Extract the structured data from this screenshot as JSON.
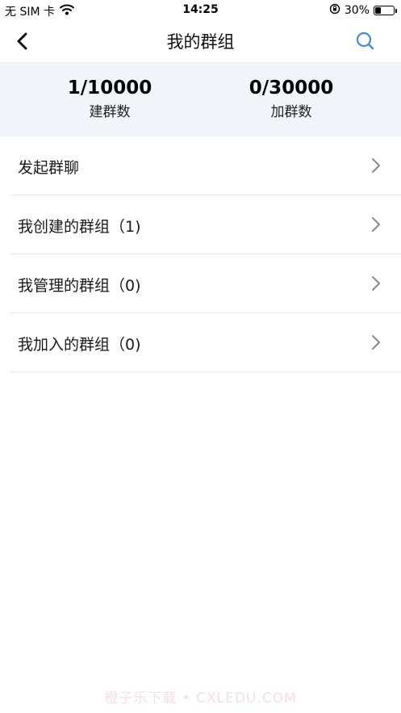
{
  "status_bar": {
    "carrier": "无 SIM 卡",
    "time": "14:25",
    "battery_percent": "30%",
    "battery_level": 0.3
  },
  "nav": {
    "title": "我的群组"
  },
  "stats": [
    {
      "value": "1/10000",
      "label": "建群数"
    },
    {
      "value": "0/30000",
      "label": "加群数"
    }
  ],
  "list": [
    {
      "label": "发起群聊"
    },
    {
      "label": "我创建的群组（1)"
    },
    {
      "label": "我管理的群组（0)"
    },
    {
      "label": "我加入的群组（0)"
    }
  ],
  "watermark": "橙子乐下载 • CXLEDU.COM",
  "colors": {
    "accent": "#3a8ee6",
    "stats_background": "#f1f4f9"
  }
}
